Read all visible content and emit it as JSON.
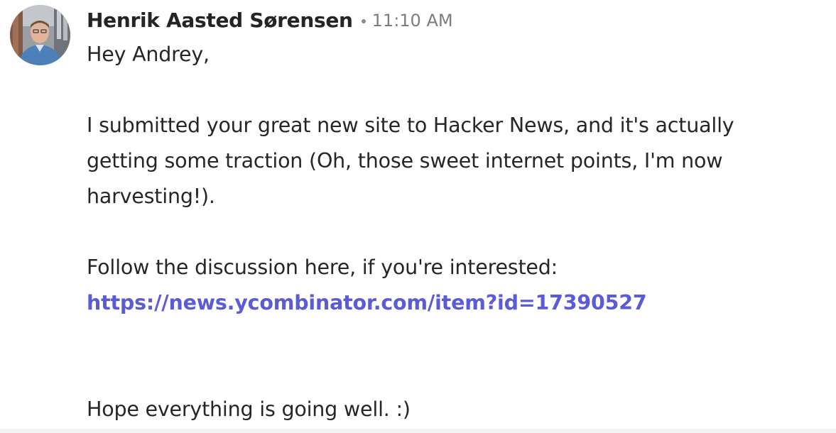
{
  "message": {
    "author": "Henrik Aasted Sørensen",
    "timestamp": "11:10 AM",
    "greeting": "Hey Andrey,",
    "paragraph1": "I submitted your great new site to Hacker News, and it's actually getting some traction (Oh, those sweet internet points, I'm now harvesting!).",
    "paragraph2_intro": "Follow the discussion here, if you're interested:",
    "link": "https://news.ycombinator.com/item?id=17390527",
    "closing": "Hope everything is going well. :)"
  },
  "colors": {
    "link": "#5b5bd6",
    "text": "#262626",
    "timestamp": "#7d7d7d"
  },
  "icons": {
    "avatar": "user-photo-avatar"
  }
}
